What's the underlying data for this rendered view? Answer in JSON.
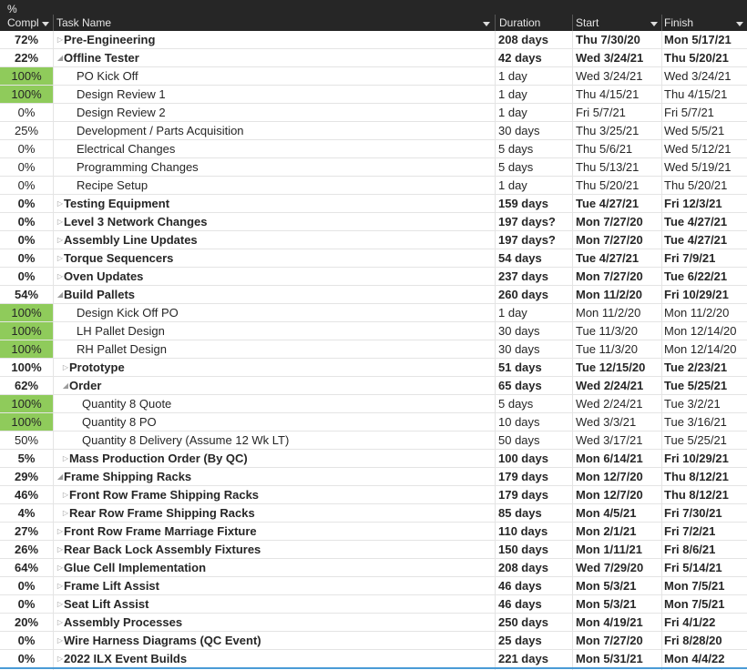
{
  "columns": {
    "pct_top": "%",
    "pct": "Compl",
    "name": "Task Name",
    "duration": "Duration",
    "start": "Start",
    "finish": "Finish"
  },
  "rows": [
    {
      "pct": "72%",
      "name": "Pre-Engineering",
      "duration": "208 days",
      "start": "Thu 7/30/20",
      "finish": "Mon 5/17/21",
      "summary": true,
      "expanded": false,
      "level": 0,
      "done": false
    },
    {
      "pct": "22%",
      "name": "Offline Tester",
      "duration": "42 days",
      "start": "Wed 3/24/21",
      "finish": "Thu 5/20/21",
      "summary": true,
      "expanded": true,
      "level": 0,
      "done": false
    },
    {
      "pct": "100%",
      "name": "PO Kick Off",
      "duration": "1 day",
      "start": "Wed 3/24/21",
      "finish": "Wed 3/24/21",
      "summary": false,
      "level": 1,
      "done": true
    },
    {
      "pct": "100%",
      "name": "Design Review 1",
      "duration": "1 day",
      "start": "Thu 4/15/21",
      "finish": "Thu 4/15/21",
      "summary": false,
      "level": 1,
      "done": true
    },
    {
      "pct": "0%",
      "name": "Design Review 2",
      "duration": "1 day",
      "start": "Fri 5/7/21",
      "finish": "Fri 5/7/21",
      "summary": false,
      "level": 1,
      "done": false
    },
    {
      "pct": "25%",
      "name": "Development / Parts Acquisition",
      "duration": "30 days",
      "start": "Thu 3/25/21",
      "finish": "Wed 5/5/21",
      "summary": false,
      "level": 1,
      "done": false
    },
    {
      "pct": "0%",
      "name": "Electrical Changes",
      "duration": "5 days",
      "start": "Thu 5/6/21",
      "finish": "Wed 5/12/21",
      "summary": false,
      "level": 1,
      "done": false
    },
    {
      "pct": "0%",
      "name": "Programming Changes",
      "duration": "5 days",
      "start": "Thu 5/13/21",
      "finish": "Wed 5/19/21",
      "summary": false,
      "level": 1,
      "done": false
    },
    {
      "pct": "0%",
      "name": "Recipe Setup",
      "duration": "1 day",
      "start": "Thu 5/20/21",
      "finish": "Thu 5/20/21",
      "summary": false,
      "level": 1,
      "done": false
    },
    {
      "pct": "0%",
      "name": "Testing Equipment",
      "duration": "159 days",
      "start": "Tue 4/27/21",
      "finish": "Fri 12/3/21",
      "summary": true,
      "expanded": false,
      "level": 0,
      "done": false
    },
    {
      "pct": "0%",
      "name": "Level 3 Network Changes",
      "duration": "197 days?",
      "start": "Mon 7/27/20",
      "finish": "Tue 4/27/21",
      "summary": true,
      "expanded": false,
      "level": 0,
      "done": false
    },
    {
      "pct": "0%",
      "name": "Assembly Line Updates",
      "duration": "197 days?",
      "start": "Mon 7/27/20",
      "finish": "Tue 4/27/21",
      "summary": true,
      "expanded": false,
      "level": 0,
      "done": false
    },
    {
      "pct": "0%",
      "name": "Torque Sequencers",
      "duration": "54 days",
      "start": "Tue 4/27/21",
      "finish": "Fri 7/9/21",
      "summary": true,
      "expanded": false,
      "level": 0,
      "done": false
    },
    {
      "pct": "0%",
      "name": "Oven Updates",
      "duration": "237 days",
      "start": "Mon 7/27/20",
      "finish": "Tue 6/22/21",
      "summary": true,
      "expanded": false,
      "level": 0,
      "done": false
    },
    {
      "pct": "54%",
      "name": "Build Pallets",
      "duration": "260 days",
      "start": "Mon 11/2/20",
      "finish": "Fri 10/29/21",
      "summary": true,
      "expanded": true,
      "level": 0,
      "done": false
    },
    {
      "pct": "100%",
      "name": "Design Kick Off PO",
      "duration": "1 day",
      "start": "Mon 11/2/20",
      "finish": "Mon 11/2/20",
      "summary": false,
      "level": 1,
      "done": true
    },
    {
      "pct": "100%",
      "name": "LH Pallet Design",
      "duration": "30 days",
      "start": "Tue 11/3/20",
      "finish": "Mon 12/14/20",
      "summary": false,
      "level": 1,
      "done": true
    },
    {
      "pct": "100%",
      "name": "RH Pallet Design",
      "duration": "30 days",
      "start": "Tue 11/3/20",
      "finish": "Mon 12/14/20",
      "summary": false,
      "level": 1,
      "done": true
    },
    {
      "pct": "100%",
      "name": "Prototype",
      "duration": "51 days",
      "start": "Tue 12/15/20",
      "finish": "Tue 2/23/21",
      "summary": true,
      "expanded": false,
      "level": 1,
      "done": false
    },
    {
      "pct": "62%",
      "name": "Order",
      "duration": "65 days",
      "start": "Wed 2/24/21",
      "finish": "Tue 5/25/21",
      "summary": true,
      "expanded": true,
      "level": 1,
      "done": false
    },
    {
      "pct": "100%",
      "name": "Quantity 8 Quote",
      "duration": "5 days",
      "start": "Wed 2/24/21",
      "finish": "Tue 3/2/21",
      "summary": false,
      "level": 2,
      "done": true
    },
    {
      "pct": "100%",
      "name": "Quantity 8 PO",
      "duration": "10 days",
      "start": "Wed 3/3/21",
      "finish": "Tue 3/16/21",
      "summary": false,
      "level": 2,
      "done": true
    },
    {
      "pct": "50%",
      "name": "Quantity 8 Delivery (Assume 12 Wk LT)",
      "duration": "50 days",
      "start": "Wed 3/17/21",
      "finish": "Tue 5/25/21",
      "summary": false,
      "level": 2,
      "done": false
    },
    {
      "pct": "5%",
      "name": "Mass Production Order (By QC)",
      "duration": "100 days",
      "start": "Mon 6/14/21",
      "finish": "Fri 10/29/21",
      "summary": true,
      "expanded": false,
      "level": 1,
      "done": false
    },
    {
      "pct": "29%",
      "name": "Frame Shipping Racks",
      "duration": "179 days",
      "start": "Mon 12/7/20",
      "finish": "Thu 8/12/21",
      "summary": true,
      "expanded": true,
      "level": 0,
      "done": false
    },
    {
      "pct": "46%",
      "name": "Front Row Frame Shipping Racks",
      "duration": "179 days",
      "start": "Mon 12/7/20",
      "finish": "Thu 8/12/21",
      "summary": true,
      "expanded": false,
      "level": 1,
      "done": false
    },
    {
      "pct": "4%",
      "name": "Rear Row Frame Shipping Racks",
      "duration": "85 days",
      "start": "Mon 4/5/21",
      "finish": "Fri 7/30/21",
      "summary": true,
      "expanded": false,
      "level": 1,
      "done": false
    },
    {
      "pct": "27%",
      "name": "Front Row Frame Marriage Fixture",
      "duration": "110 days",
      "start": "Mon 2/1/21",
      "finish": "Fri 7/2/21",
      "summary": true,
      "expanded": false,
      "level": 0,
      "done": false
    },
    {
      "pct": "26%",
      "name": "Rear Back Lock Assembly Fixtures",
      "duration": "150 days",
      "start": "Mon 1/11/21",
      "finish": "Fri 8/6/21",
      "summary": true,
      "expanded": false,
      "level": 0,
      "done": false
    },
    {
      "pct": "64%",
      "name": "Glue Cell Implementation",
      "duration": "208 days",
      "start": "Wed 7/29/20",
      "finish": "Fri 5/14/21",
      "summary": true,
      "expanded": false,
      "level": 0,
      "done": false
    },
    {
      "pct": "0%",
      "name": "Frame Lift Assist",
      "duration": "46 days",
      "start": "Mon 5/3/21",
      "finish": "Mon 7/5/21",
      "summary": true,
      "expanded": false,
      "level": 0,
      "done": false
    },
    {
      "pct": "0%",
      "name": "Seat Lift Assist",
      "duration": "46 days",
      "start": "Mon 5/3/21",
      "finish": "Mon 7/5/21",
      "summary": true,
      "expanded": false,
      "level": 0,
      "done": false
    },
    {
      "pct": "20%",
      "name": "Assembly Processes",
      "duration": "250 days",
      "start": "Mon 4/19/21",
      "finish": "Fri 4/1/22",
      "summary": true,
      "expanded": false,
      "level": 0,
      "done": false
    },
    {
      "pct": "0%",
      "name": "Wire Harness Diagrams (QC Event)",
      "duration": "25 days",
      "start": "Mon 7/27/20",
      "finish": "Fri 8/28/20",
      "summary": true,
      "expanded": false,
      "level": 0,
      "done": false
    },
    {
      "pct": "0%",
      "name": "2022 ILX Event Builds",
      "duration": "221 days",
      "start": "Mon 5/31/21",
      "finish": "Mon 4/4/22",
      "summary": true,
      "expanded": false,
      "level": 0,
      "done": false
    }
  ],
  "colors": {
    "header_bg": "#262626",
    "complete_fill": "#8fcb5b",
    "selection_line": "#4a9bd6"
  }
}
